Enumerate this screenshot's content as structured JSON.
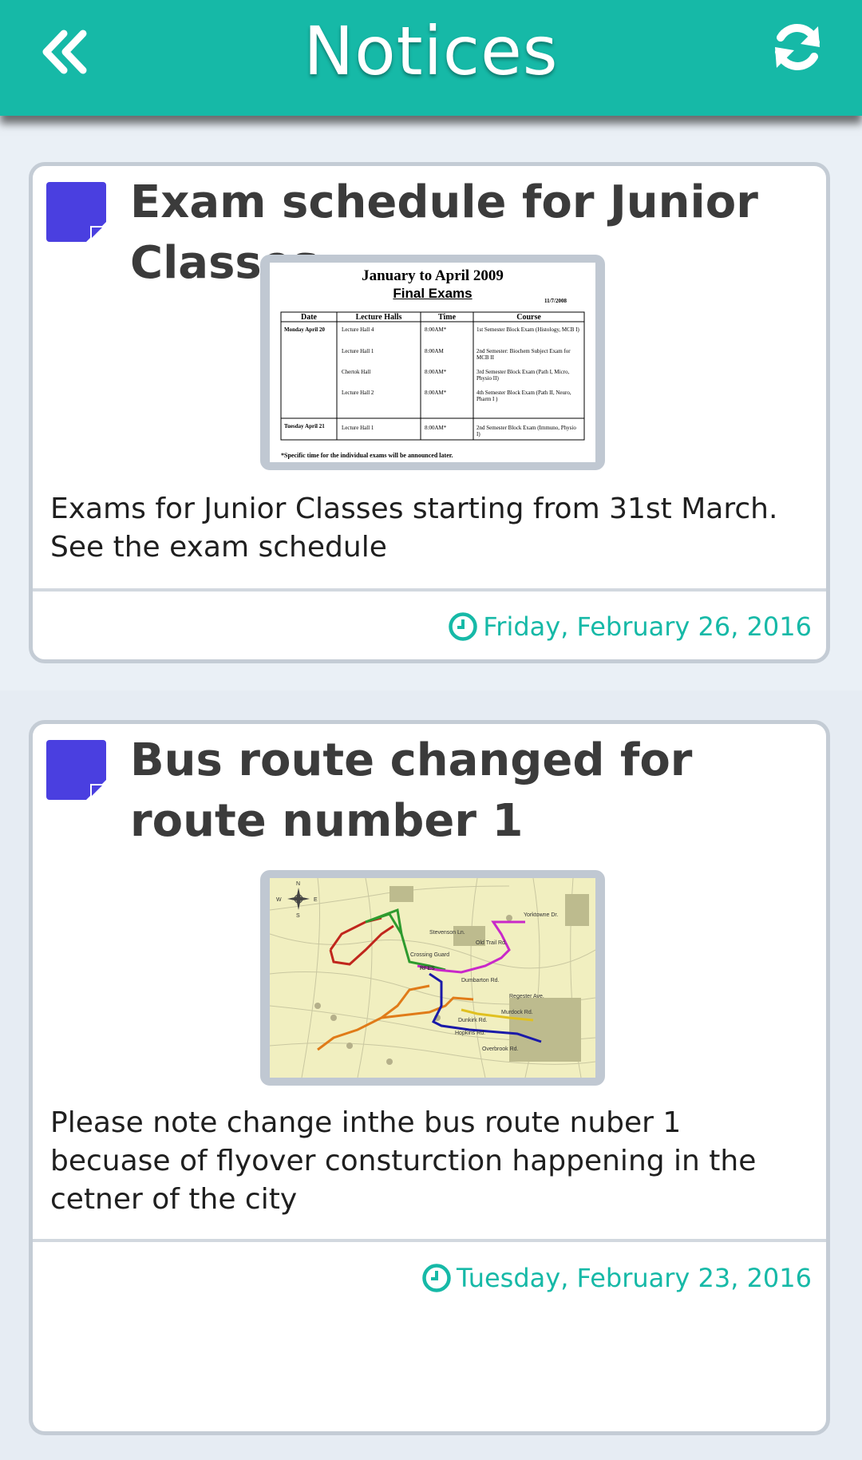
{
  "appbar": {
    "title": "Notices",
    "back_icon": "double-chevron-left-icon",
    "refresh_icon": "refresh-icon",
    "color": "#16b9a7"
  },
  "notices": [
    {
      "title": "Exam schedule for Junior Classes",
      "body": "Exams for Junior Classes starting from 31st March. See the exam schedule",
      "date": "Friday, February 26, 2016",
      "image": {
        "heading": "January to April 2009",
        "subheading": "Final Exams",
        "datestamp": "11/7/2008",
        "columns": [
          "Date",
          "Lecture Halls",
          "Time",
          "Course"
        ],
        "rows": [
          [
            "Monday April 20",
            "Lecture  Hall 4",
            "8:00AM*",
            "1st Semester Block Exam (Histology, MCB I)"
          ],
          [
            "",
            "Lecture Hall 1",
            "8:00AM",
            "2nd Semester: Biochem Subject Exam for MCB II"
          ],
          [
            "",
            "Chertok Hall",
            "8:00AM*",
            "3rd Semester Block Exam (Path I, Micro, Physio II)"
          ],
          [
            "",
            "Lecture Hall 2",
            "8:00AM*",
            "4th Semester Block Exam (Path II, Neuro, Pharm I )"
          ],
          [
            "Tuesday April 21",
            "Lecture Hall 1",
            "8:00AM*",
            "2nd Semester Block Exam (Immuno, Physio I)"
          ]
        ],
        "footnote": "*Specific time for the individual exams will be announced later."
      }
    },
    {
      "title": "Bus route changed for route number 1",
      "body": "Please note change inthe bus route nuber 1 becuase of flyover consturction happening in the cetner of the city",
      "date": "Tuesday, February 23, 2016",
      "image": {
        "compass": [
          "N",
          "E",
          "S",
          "W"
        ],
        "streets": [
          "Stevenson Ln.",
          "Old Trail Rd.",
          "Yorktowne Dr.",
          "Dumbarton Rd.",
          "Regester Ave.",
          "Murdock Rd.",
          "Dunkirk Rd.",
          "Hopkins Rd.",
          "Overbrook Rd.",
          "Crossing Guard Locations",
          "RFES"
        ]
      }
    }
  ],
  "colors": {
    "accent": "#16b9a7",
    "note_icon": "#4a3fe0",
    "background": "#e7edf4"
  }
}
